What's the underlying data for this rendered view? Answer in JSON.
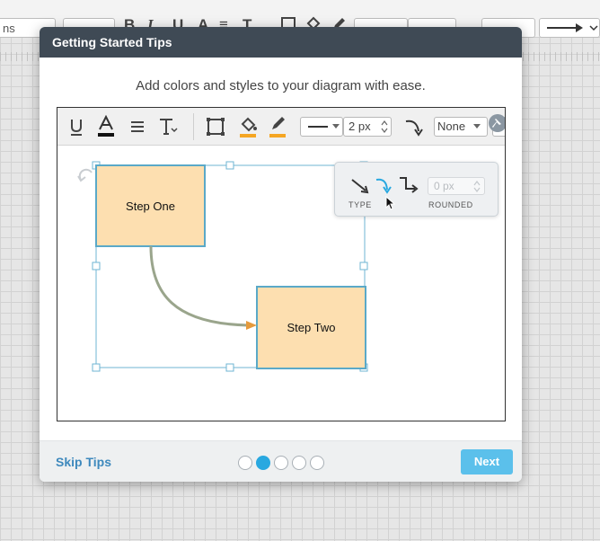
{
  "app": {
    "font_select_value": "ns",
    "toolbar_glyphs": [
      "B",
      "I",
      "U",
      "A",
      "≡",
      "T"
    ]
  },
  "modal": {
    "title": "Getting Started Tips",
    "subtitle": "Add colors and styles to your diagram with ease.",
    "demo": {
      "line_width_value": "2 px",
      "endpoint_value": "None",
      "popover": {
        "type_label": "TYPE",
        "rounded_label": "ROUNDED",
        "rounded_value": "0 px"
      },
      "shapes": {
        "step_one": "Step One",
        "step_two": "Step Two"
      }
    },
    "footer": {
      "skip_label": "Skip Tips",
      "next_label": "Next",
      "page_count": 5,
      "current_page": 2
    }
  },
  "colors": {
    "accent": "#29a8e0",
    "header_bg": "#3f4a55",
    "shape_fill": "#fddfb0",
    "shape_border": "#5aa9c8",
    "connector": "#9aa58c",
    "arrow_head": "#e59a3c"
  }
}
